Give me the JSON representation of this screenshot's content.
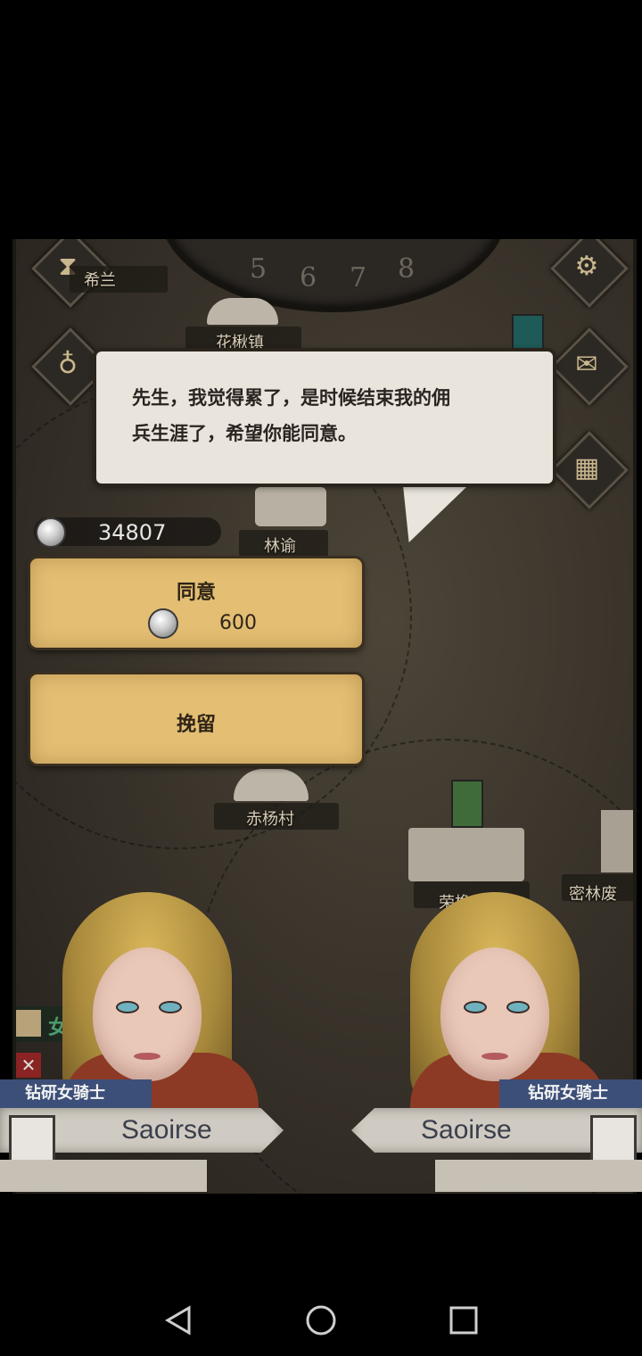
{
  "dialogue": {
    "text_line1": "先生，我觉得累了，是时候结束我的佣",
    "text_line2": "兵生涯了，希望你能同意。"
  },
  "currency": {
    "icon": "silver-coin-icon",
    "amount": "34807"
  },
  "choices": [
    {
      "label": "同意",
      "cost": "600"
    },
    {
      "label": "挽留"
    }
  ],
  "map": {
    "towns": [
      "花楸镇",
      "林谕",
      "赤杨村",
      "荣橡",
      "密林废",
      "希兰"
    ],
    "status_label": "女王"
  },
  "characters": [
    {
      "class": "钻研女骑士",
      "name": "Saoirse"
    },
    {
      "class": "钻研女骑士",
      "name": "Saoirse"
    }
  ],
  "dial_numbers": [
    "5",
    "6",
    "7",
    "8"
  ],
  "colors": {
    "dialog_bg": "#e9e5dd",
    "button_bg": "#e3be73",
    "class_tag": "#3c4f78",
    "map_bg": "#3a342b"
  }
}
